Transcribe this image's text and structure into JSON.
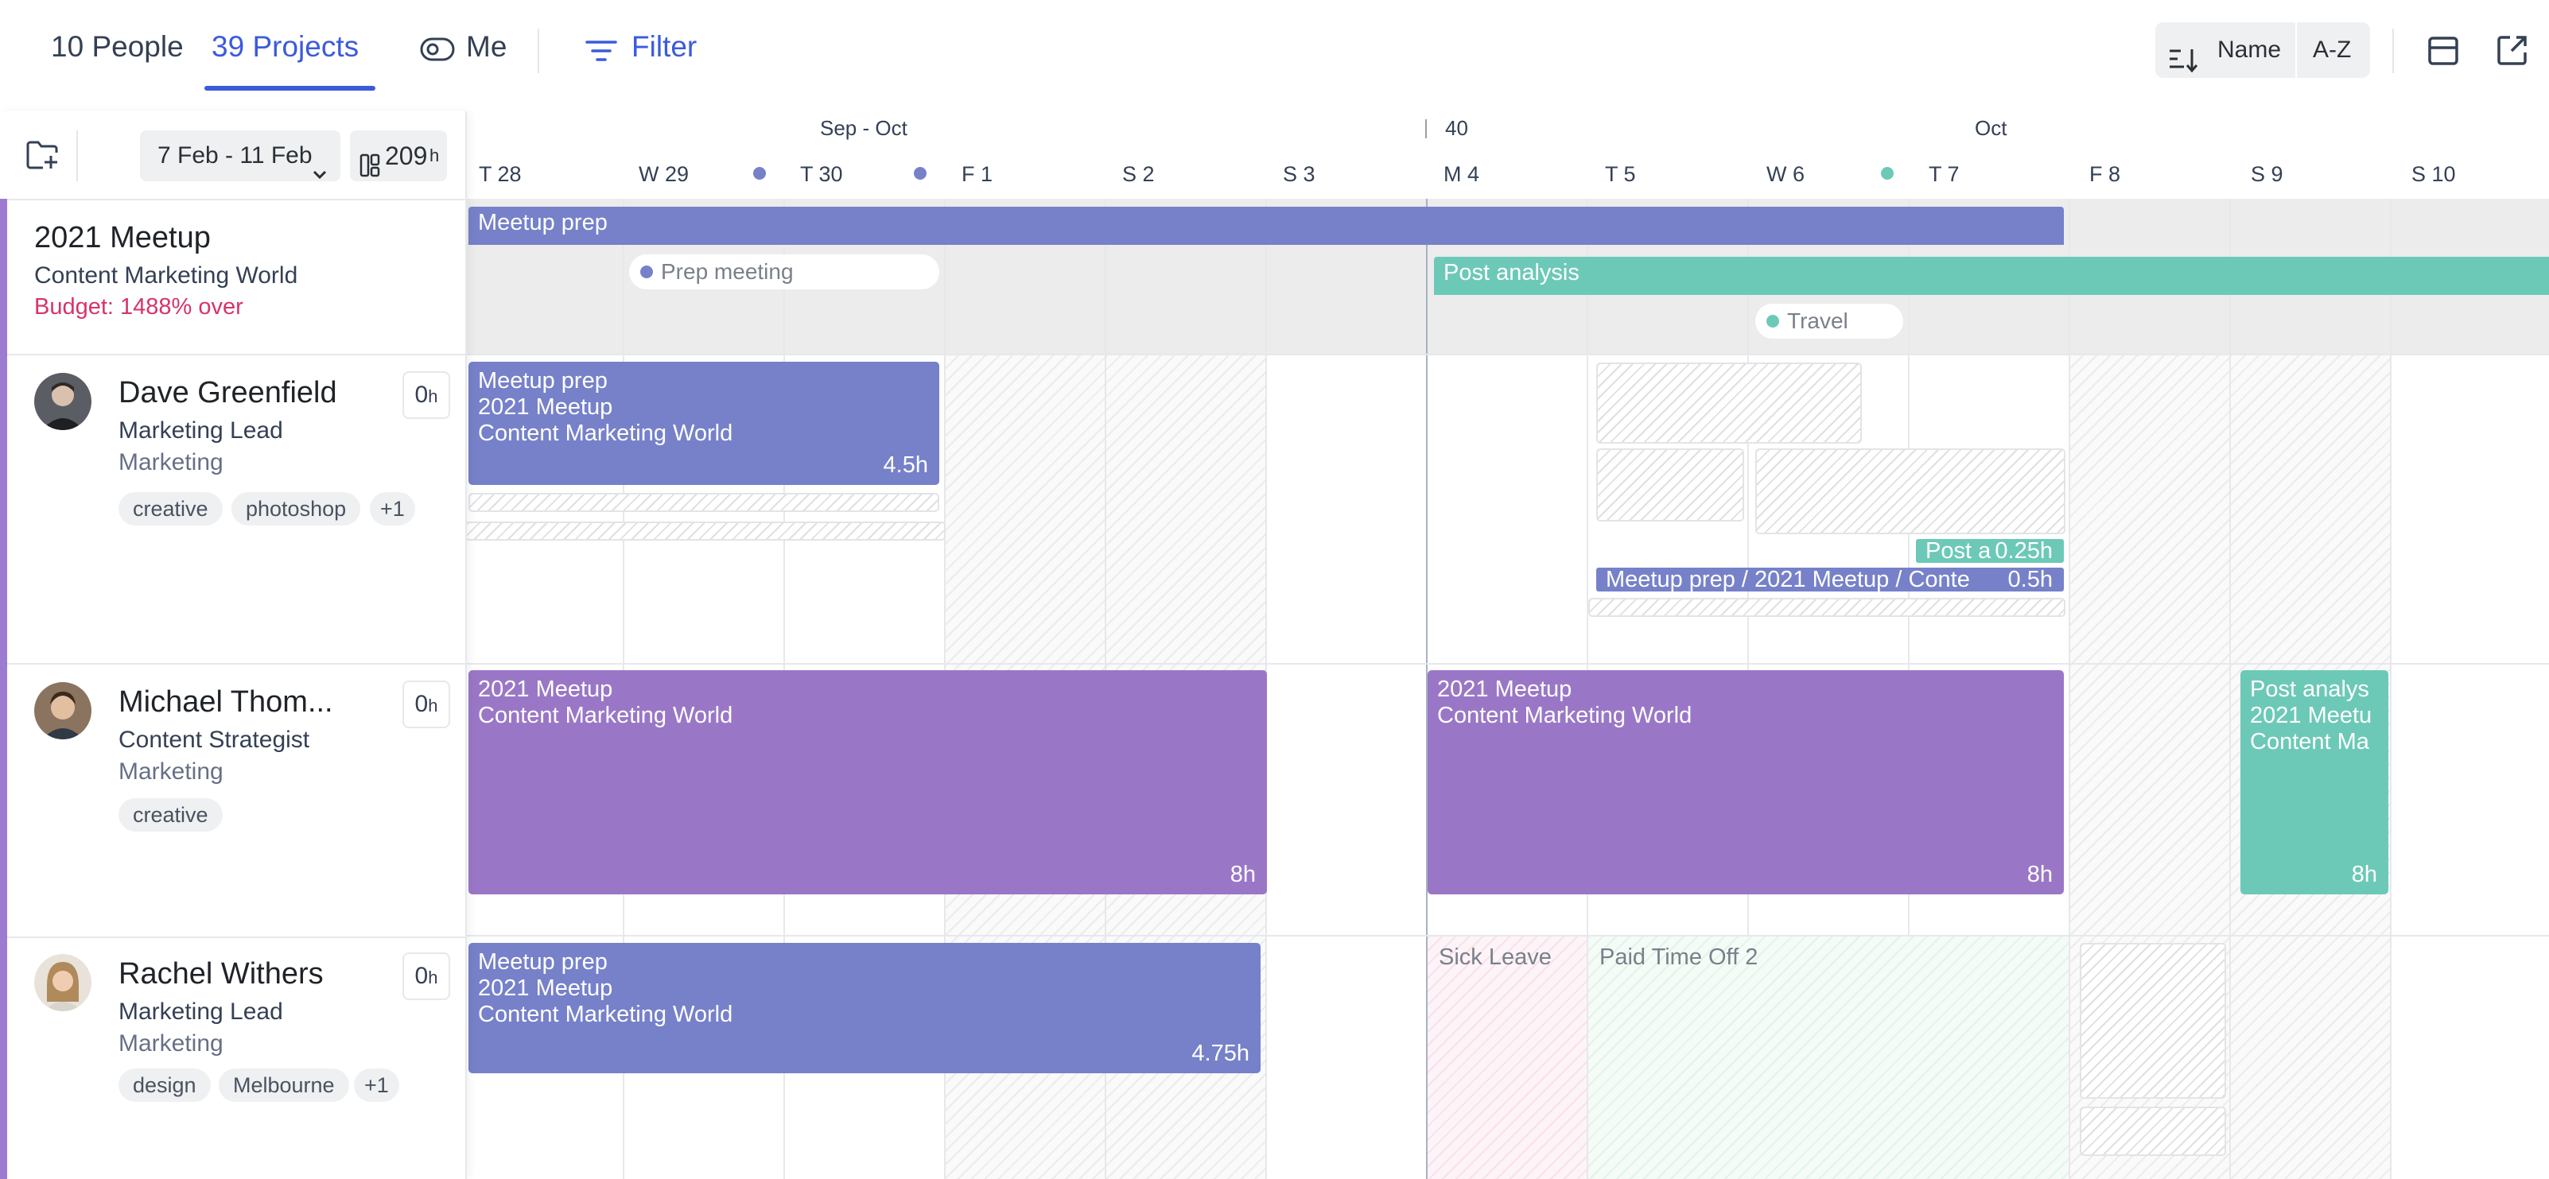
{
  "topbar": {
    "people_count": "10",
    "people_label": "People",
    "projects_count": "39",
    "projects_label": "Projects",
    "me_label": "Me",
    "filter_label": "Filter",
    "sort_name": "Name",
    "sort_order": "A-Z"
  },
  "sidebar_toolbar": {
    "date_range": "7 Feb - 11 Feb",
    "hours_value": "209",
    "hours_unit": "h"
  },
  "project": {
    "name": "2021 Meetup",
    "client": "Content Marketing World",
    "budget": "Budget: 1488% over",
    "budget_color": "#d6336c"
  },
  "people": [
    {
      "name": "Dave Greenfield",
      "role": "Marketing Lead",
      "department": "Marketing",
      "hours": "0",
      "hours_unit": "h",
      "tags": [
        "creative",
        "photoshop",
        "+1"
      ]
    },
    {
      "name": "Michael Thom...",
      "role": "Content Strategist",
      "department": "Marketing",
      "hours": "0",
      "hours_unit": "h",
      "tags": [
        "creative"
      ]
    },
    {
      "name": "Rachel Withers",
      "role": "Marketing Lead",
      "department": "Marketing",
      "hours": "0",
      "hours_unit": "h",
      "tags": [
        "design",
        "Melbourne",
        "+1"
      ]
    }
  ],
  "timeline": {
    "weeks": [
      "Sep - Oct",
      "40",
      "Oct"
    ],
    "days": [
      "T 28",
      "W 29",
      "T 30",
      "F 1",
      "S 2",
      "S 3",
      "M 4",
      "T 5",
      "W 6",
      "T 7",
      "F 8",
      "S 9",
      "S 10"
    ]
  },
  "project_row": {
    "meetup_prep": "Meetup prep",
    "prep_meeting": "Prep meeting",
    "post_analysis": "Post analysis",
    "travel": "Travel"
  },
  "dave": {
    "block1": {
      "line1": "Meetup prep",
      "line2": "2021 Meetup",
      "line3": "Content Marketing World",
      "hours": "4.5h"
    },
    "small1": {
      "label": "Post a",
      "hours": "0.25h"
    },
    "small2": {
      "label": "Meetup prep / 2021 Meetup / Conte",
      "hours": "0.5h"
    }
  },
  "michael": {
    "block1": {
      "line1": "2021 Meetup",
      "line2": "Content Marketing World",
      "hours": "8h"
    },
    "block2": {
      "line1": "2021 Meetup",
      "line2": "Content Marketing World",
      "hours": "8h"
    },
    "block3": {
      "line1": "Post analys",
      "line2": "2021 Meetu",
      "line3": "Content Ma",
      "hours": "8h"
    }
  },
  "rachel": {
    "block1": {
      "line1": "Meetup prep",
      "line2": "2021 Meetup",
      "line3": "Content Marketing World",
      "hours": "4.75h"
    },
    "sick_leave": "Sick Leave",
    "pto": "Paid Time Off 2"
  },
  "colors": {
    "accent_blue": "#3b5bdb",
    "bar_blue": "#7681c9",
    "bar_purple": "#9a77c6",
    "bar_teal": "#6dc9b7",
    "sidebar_accent": "#9d7bd1"
  }
}
